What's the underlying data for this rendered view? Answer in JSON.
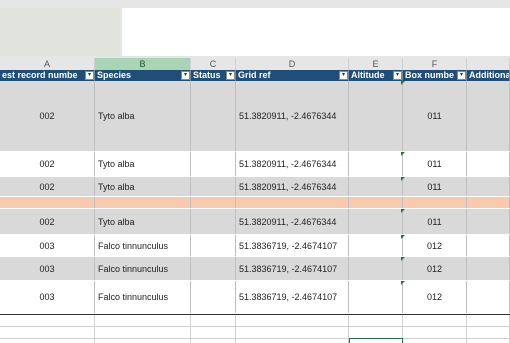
{
  "columns": [
    {
      "letter": "A",
      "header": "est record numbe"
    },
    {
      "letter": "B",
      "header": "Species"
    },
    {
      "letter": "C",
      "header": "Status"
    },
    {
      "letter": "D",
      "header": "Grid ref"
    },
    {
      "letter": "E",
      "header": "Altitude"
    },
    {
      "letter": "F",
      "header": "Box numbe"
    },
    {
      "letter": "",
      "header": "Additiona"
    }
  ],
  "rows": [
    {
      "record": "002",
      "species": "Tyto alba",
      "status": "",
      "grid": "51.3820911, -2.4676344",
      "altitude": "",
      "box": "011",
      "fill": "#d9d9d9"
    },
    {
      "record": "002",
      "species": "Tyto alba",
      "status": "",
      "grid": "51.3820911, -2.4676344",
      "altitude": "",
      "box": "011",
      "fill": "#ffffff"
    },
    {
      "record": "002",
      "species": "Tyto alba",
      "status": "",
      "grid": "51.3820911, -2.4676344",
      "altitude": "",
      "box": "011",
      "fill": "#d9d9d9"
    },
    {
      "record": "",
      "species": "",
      "status": "",
      "grid": "",
      "altitude": "",
      "box": "",
      "fill": "#f8cbad"
    },
    {
      "record": "002",
      "species": "Tyto alba",
      "status": "",
      "grid": "51.3820911, -2.4676344",
      "altitude": "",
      "box": "011",
      "fill": "#d9d9d9"
    },
    {
      "record": "003",
      "species": "Falco tinnunculus",
      "status": "",
      "grid": "51.3836719, -2.4674107",
      "altitude": "",
      "box": "012",
      "fill": "#ffffff"
    },
    {
      "record": "003",
      "species": "Falco tinnunculus",
      "status": "",
      "grid": "51.3836719, -2.4674107",
      "altitude": "",
      "box": "012",
      "fill": "#d9d9d9"
    },
    {
      "record": "003",
      "species": "Falco tinnunculus",
      "status": "",
      "grid": "51.3836719, -2.4674107",
      "altitude": "",
      "box": "012",
      "fill": "#ffffff"
    }
  ],
  "colors": {
    "header_bg": "#1f4e79",
    "selected_column": "#a9d5b4",
    "comment_marker": "#1e7a32"
  }
}
